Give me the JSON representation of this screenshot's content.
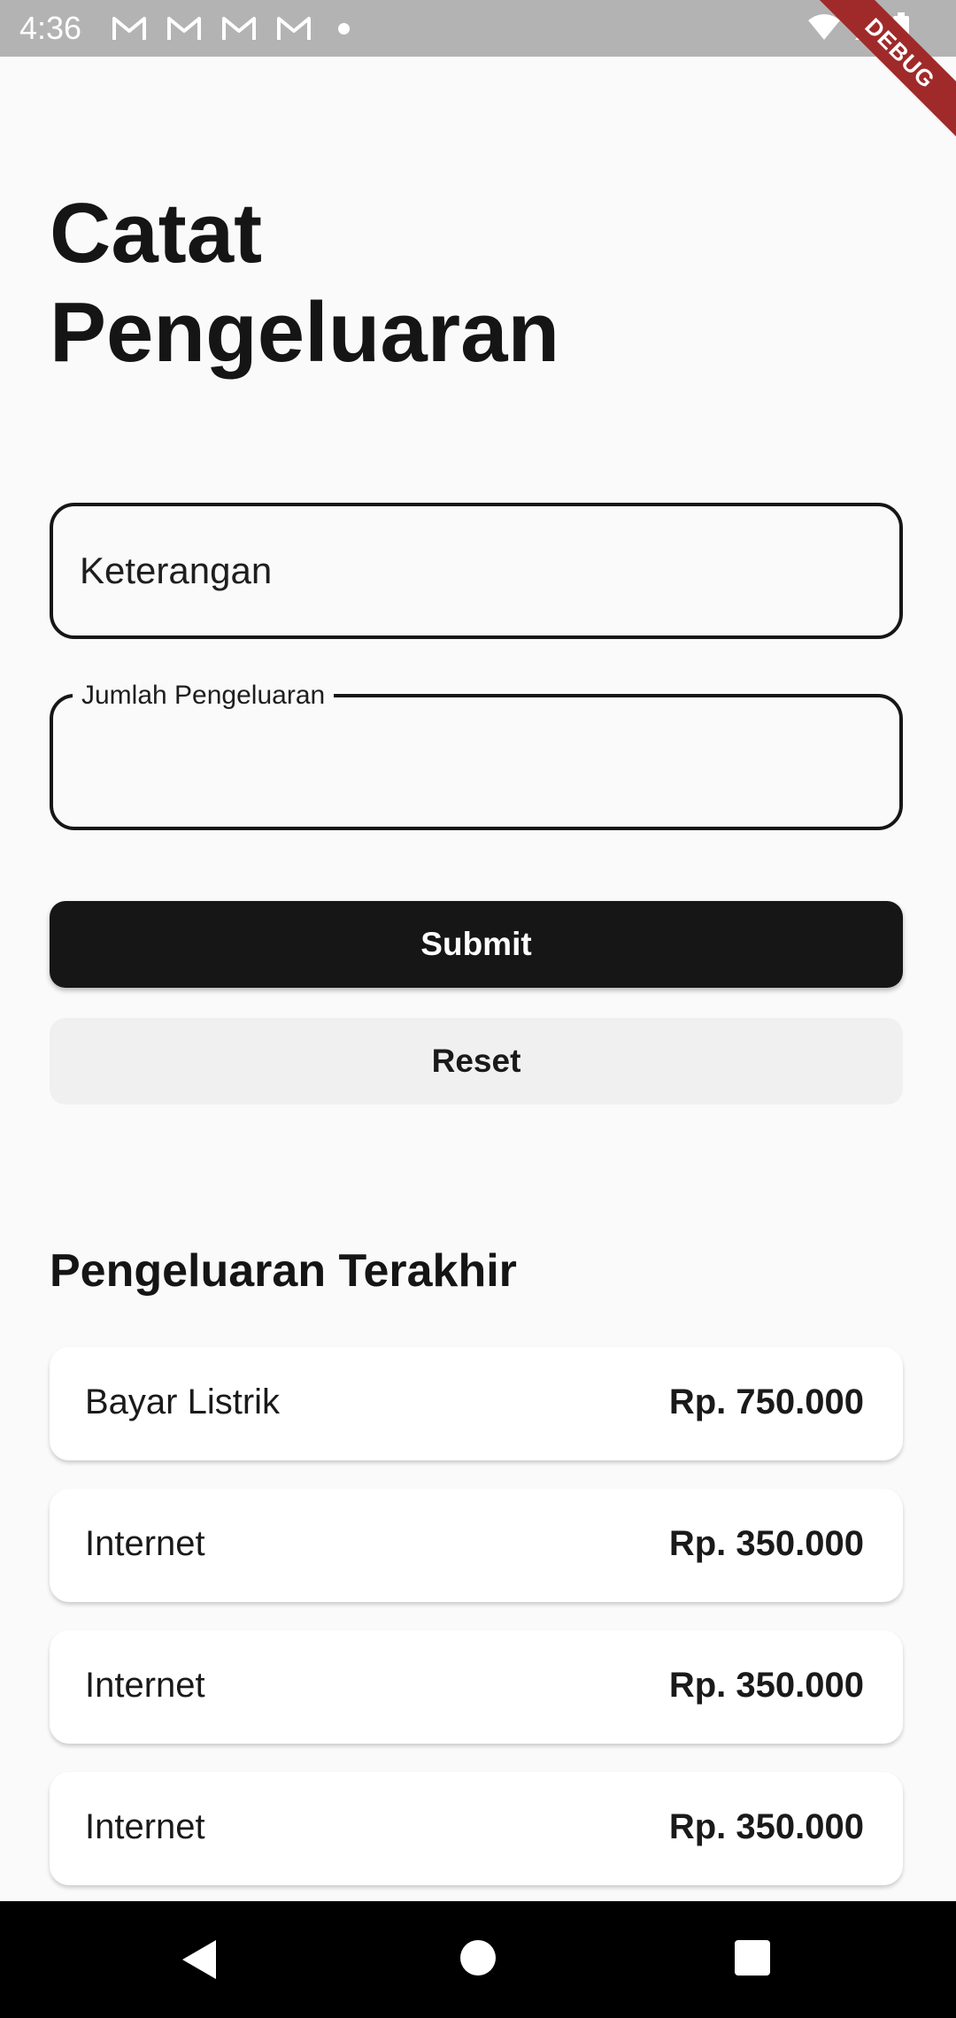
{
  "status_bar": {
    "time": "4:36",
    "notification_icons": [
      "gmail-icon",
      "gmail-icon",
      "gmail-icon",
      "gmail-icon"
    ],
    "right_icons": [
      "wifi-icon",
      "cellular-signal-icon",
      "battery-icon"
    ]
  },
  "debug_banner": {
    "label": "DEBUG",
    "color": "#a02a2a"
  },
  "page": {
    "title": "Catat Pengeluaran"
  },
  "form": {
    "keterangan": {
      "placeholder": "Keterangan",
      "value": ""
    },
    "jumlah": {
      "label": "Jumlah Pengeluaran",
      "value": ""
    },
    "submit_label": "Submit",
    "reset_label": "Reset"
  },
  "recent": {
    "title": "Pengeluaran Terakhir",
    "items": [
      {
        "name": "Bayar Listrik",
        "amount": "Rp. 750.000"
      },
      {
        "name": "Internet",
        "amount": "Rp. 350.000"
      },
      {
        "name": "Internet",
        "amount": "Rp. 350.000"
      },
      {
        "name": "Internet",
        "amount": "Rp. 350.000"
      }
    ]
  },
  "nav_bar": {
    "buttons": [
      "back-icon",
      "home-icon",
      "recents-icon"
    ]
  },
  "colors": {
    "primary_button": "#161616",
    "secondary_button": "#f0f0f0",
    "background": "#fafafa",
    "status_bar": "#b3b3b3"
  }
}
